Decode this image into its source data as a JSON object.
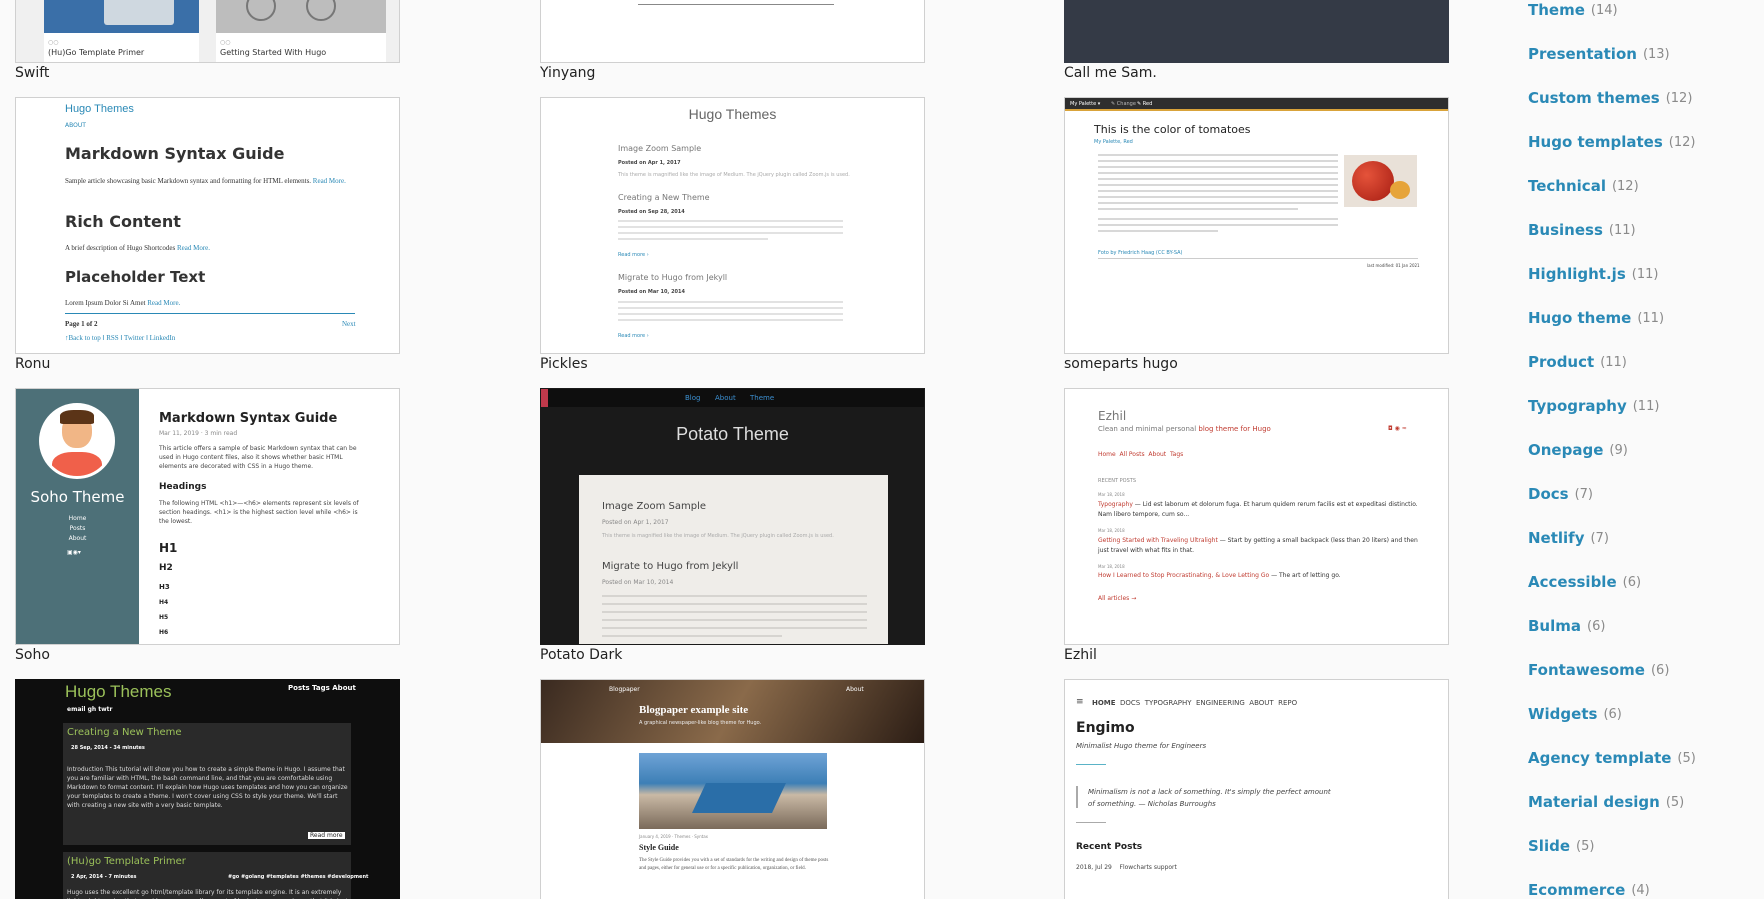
{
  "themes": [
    {
      "name": "Swift"
    },
    {
      "name": "Yinyang"
    },
    {
      "name": "Call me Sam."
    },
    {
      "name": "Ronu"
    },
    {
      "name": "Pickles"
    },
    {
      "name": "someparts hugo"
    },
    {
      "name": "Soho"
    },
    {
      "name": "Potato Dark"
    },
    {
      "name": "Ezhil"
    }
  ],
  "previews": {
    "swift": {
      "left_caption": "(Hu)Go Template Primer",
      "right_caption": "Getting Started With Hugo"
    },
    "ronu": {
      "site_title": "Hugo Themes",
      "about": "ABOUT",
      "h1": "Markdown Syntax Guide",
      "p1": "Sample article showcasing basic Markdown syntax and formatting for HTML elements.",
      "read_more": "Read More.",
      "h2": "Rich Content",
      "p2": "A brief description of Hugo Shortcodes",
      "h3": "Placeholder Text",
      "p3": "Lorem Ipsum Dolor Si Amet",
      "page": "Page 1 of 2",
      "next": "Next",
      "footer": "↑Back to top ‖ RSS ‖ Twitter ‖ LinkedIn"
    },
    "pickles": {
      "title": "Hugo Themes",
      "posts": [
        {
          "title": "Image Zoom Sample",
          "date": "Posted on Apr 1, 2017",
          "desc": "This theme is magnified like the image of Medium. The jQuery plugin called Zoom.js is used."
        },
        {
          "title": "Creating a New Theme",
          "date": "Posted on Sep 28, 2014",
          "desc": "Introduction This tutorial will show you how to create a simple theme in Hugo.",
          "more": "Read more ›"
        },
        {
          "title": "Migrate to Hugo from Jekyll",
          "date": "Posted on Mar 10, 2014",
          "desc": "Move static content to static Jekyll has a rule that any directory not starting with _ will be copied.",
          "more": "Read more ›"
        }
      ]
    },
    "someparts": {
      "nav": [
        "My Palette ▾",
        "✎ Change",
        "✎ Red"
      ],
      "title": "This is the color of tomatoes",
      "breadcrumb": "My Palette, Red",
      "credit": "Foto by Friedrich Haag (CC BY-SA)",
      "modified": "last modified: 01 Jan 2021"
    },
    "soho": {
      "site": "Soho Theme",
      "nav": [
        "Home",
        "Posts",
        "About"
      ],
      "title": "Markdown Syntax Guide",
      "meta": "Mar 11, 2019 · 3 min read",
      "intro": "This article offers a sample of basic Markdown syntax that can be used in Hugo content files, also it shows whether basic HTML elements are decorated with CSS in a Hugo theme.",
      "headings_title": "Headings",
      "headings_text": "The following HTML <h1>—<h6> elements represent six levels of section headings. <h1> is the highest section level while <h6> is the lowest.",
      "h": [
        "H1",
        "H2",
        "H3",
        "H4",
        "H5",
        "H6"
      ]
    },
    "potato": {
      "nav": [
        "Blog",
        "About",
        "Theme"
      ],
      "title": "Potato Theme",
      "posts": [
        {
          "title": "Image Zoom Sample",
          "date": "Posted on Apr 1, 2017",
          "desc": "This theme is magnified like the image of Medium. The jQuery plugin called Zoom.js is used."
        },
        {
          "title": "Migrate to Hugo from Jekyll",
          "date": "Posted on Mar 10, 2014",
          "desc": "Move static content to static Jekyll has a rule that any directory not starting with _ will be copied as-is to the _site output. Hugo keeps all static content under static."
        }
      ]
    },
    "ezhil": {
      "title": "Ezhil",
      "subtitle_a": "Clean and minimal personal ",
      "subtitle_b": "blog theme for Hugo",
      "nav": [
        "Home",
        "All Posts",
        "About",
        "Tags"
      ],
      "recent": "RECENT POSTS",
      "posts": [
        {
          "date": "Mar 18, 2018",
          "link": "Typography",
          "text": " — Lid est laborum et dolorum fuga. Et harum quidem rerum facilis est et expeditasi distinctio. Nam libero tempore, cum so..."
        },
        {
          "date": "Mar 18, 2018",
          "link": "Getting Started with Traveling Ultralight",
          "text": " — Start by getting a small backpack (less than 20 liters) and then just travel with what fits in that."
        },
        {
          "date": "Mar 18, 2018",
          "link": "How I Learned to Stop Procrastinating, & Love Letting Go",
          "text": " — The art of letting go."
        }
      ],
      "all": "All articles →"
    },
    "hugothemes_dark": {
      "title": "Hugo Themes",
      "nav": "Posts Tags About",
      "sub": "email gh twtr",
      "post1_title": "Creating a New Theme",
      "post1_meta": "28 Sep, 2014 - 34 minutes",
      "post1_text": "Introduction This tutorial will show you how to create a simple theme in Hugo. I assume that you are familiar with HTML, the bash command line, and that you are comfortable using Markdown to format content. I'll explain how Hugo uses templates and how you can organize your templates to create a theme. I won't cover using CSS to style your theme. We'll start with creating a new site with a very basic template.",
      "read_more": "Read more",
      "post2_title": "(Hu)go Template Primer",
      "post2_meta": "2 Apr, 2014 - 7 minutes",
      "post2_tags": "#go #golang #templates #themes #development",
      "post2_text": "Hugo uses the excellent go html/template library for its template engine. It is an extremely lightweight engine that provides a very small amount of logic. In our experience that it is just the right amount of logic to be able to create a good static website. If you have used other"
    },
    "blogpaper": {
      "brand": "Blogpaper",
      "about": "About",
      "title": "Blogpaper example site",
      "subtitle": "A graphical newspaper-like blog theme for Hugo.",
      "meta": "January 4, 2019 · Themes · Syntax",
      "post_title": "Style Guide",
      "post_text": "The Style Guide provides you with a set of standards for the writing and design of theme posts and pages, either for general use or for a specific publication, organization, or field."
    },
    "engimo": {
      "nav": [
        "HOME",
        "DOCS",
        "TYPOGRAPHY",
        "ENGINEERING",
        "ABOUT",
        "REPO"
      ],
      "title": "Engimo",
      "tagline": "Minimalist Hugo theme for Engineers",
      "quote": "Minimalism is not a lack of something. It's simply the perfect amount of something. — Nicholas Burroughs",
      "recent": "Recent Posts",
      "post_date": "2018, Jul 29",
      "post": "Flowcharts support"
    }
  },
  "tags": [
    {
      "name": "Theme",
      "count": "(14)"
    },
    {
      "name": "Presentation",
      "count": "(13)"
    },
    {
      "name": "Custom themes",
      "count": "(12)"
    },
    {
      "name": "Hugo templates",
      "count": "(12)"
    },
    {
      "name": "Technical",
      "count": "(12)"
    },
    {
      "name": "Business",
      "count": "(11)"
    },
    {
      "name": "Highlight.js",
      "count": "(11)"
    },
    {
      "name": "Hugo theme",
      "count": "(11)"
    },
    {
      "name": "Product",
      "count": "(11)"
    },
    {
      "name": "Typography",
      "count": "(11)"
    },
    {
      "name": "Onepage",
      "count": "(9)"
    },
    {
      "name": "Docs",
      "count": "(7)"
    },
    {
      "name": "Netlify",
      "count": "(7)"
    },
    {
      "name": "Accessible",
      "count": "(6)"
    },
    {
      "name": "Bulma",
      "count": "(6)"
    },
    {
      "name": "Fontawesome",
      "count": "(6)"
    },
    {
      "name": "Widgets",
      "count": "(6)"
    },
    {
      "name": "Agency template",
      "count": "(5)"
    },
    {
      "name": "Material design",
      "count": "(5)"
    },
    {
      "name": "Slide",
      "count": "(5)"
    },
    {
      "name": "Ecommerce",
      "count": "(4)"
    }
  ]
}
